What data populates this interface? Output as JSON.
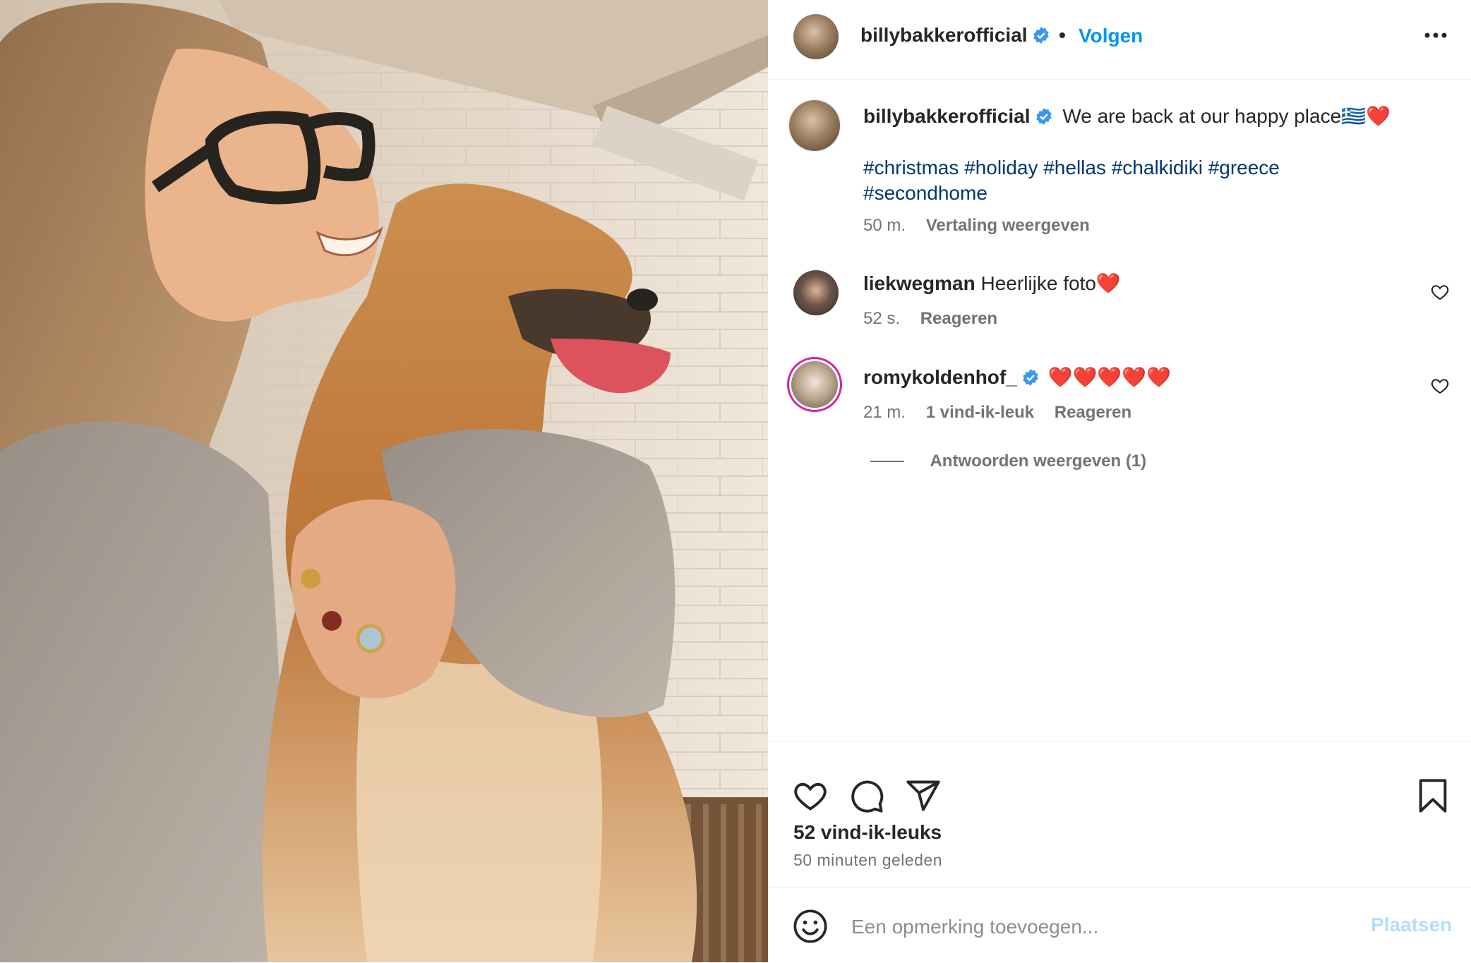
{
  "post": {
    "username": "billybakkerofficial",
    "follow_label": "Volgen",
    "dot": "•",
    "verified_icon": "verified-badge-icon",
    "more_icon": "more-options-icon"
  },
  "caption": {
    "username": "billybakkerofficial",
    "text": "We are back at our happy place🇬🇷❤️",
    "hashtags_line1": "#christmas #holiday #hellas #chalkidiki #greece",
    "hashtags_line2": "#secondhome",
    "time": "50 m.",
    "translate_label": "Vertaling weergeven"
  },
  "comments": [
    {
      "username": "liekwegman",
      "text": "Heerlijke foto❤️",
      "time": "52 s.",
      "reply_label": "Reageren"
    },
    {
      "username": "romykoldenhof_",
      "text": "❤️❤️❤️❤️❤️",
      "time": "21 m.",
      "likes_label": "1 vind-ik-leuk",
      "reply_label": "Reageren",
      "view_replies_label": "Antwoorden weergeven (1)"
    }
  ],
  "stats": {
    "likes": "52 vind-ik-leuks",
    "posted": "50 minuten geleden"
  },
  "comment_box": {
    "placeholder": "Een opmerking toevoegen...",
    "post_label": "Plaatsen",
    "emoji_icon": "emoji-icon"
  },
  "colors": {
    "accent": "#0095f6",
    "hashtag": "#00376b",
    "muted": "#737373",
    "post_disabled": "#b2dffc",
    "story_ring": "#d6249f"
  }
}
